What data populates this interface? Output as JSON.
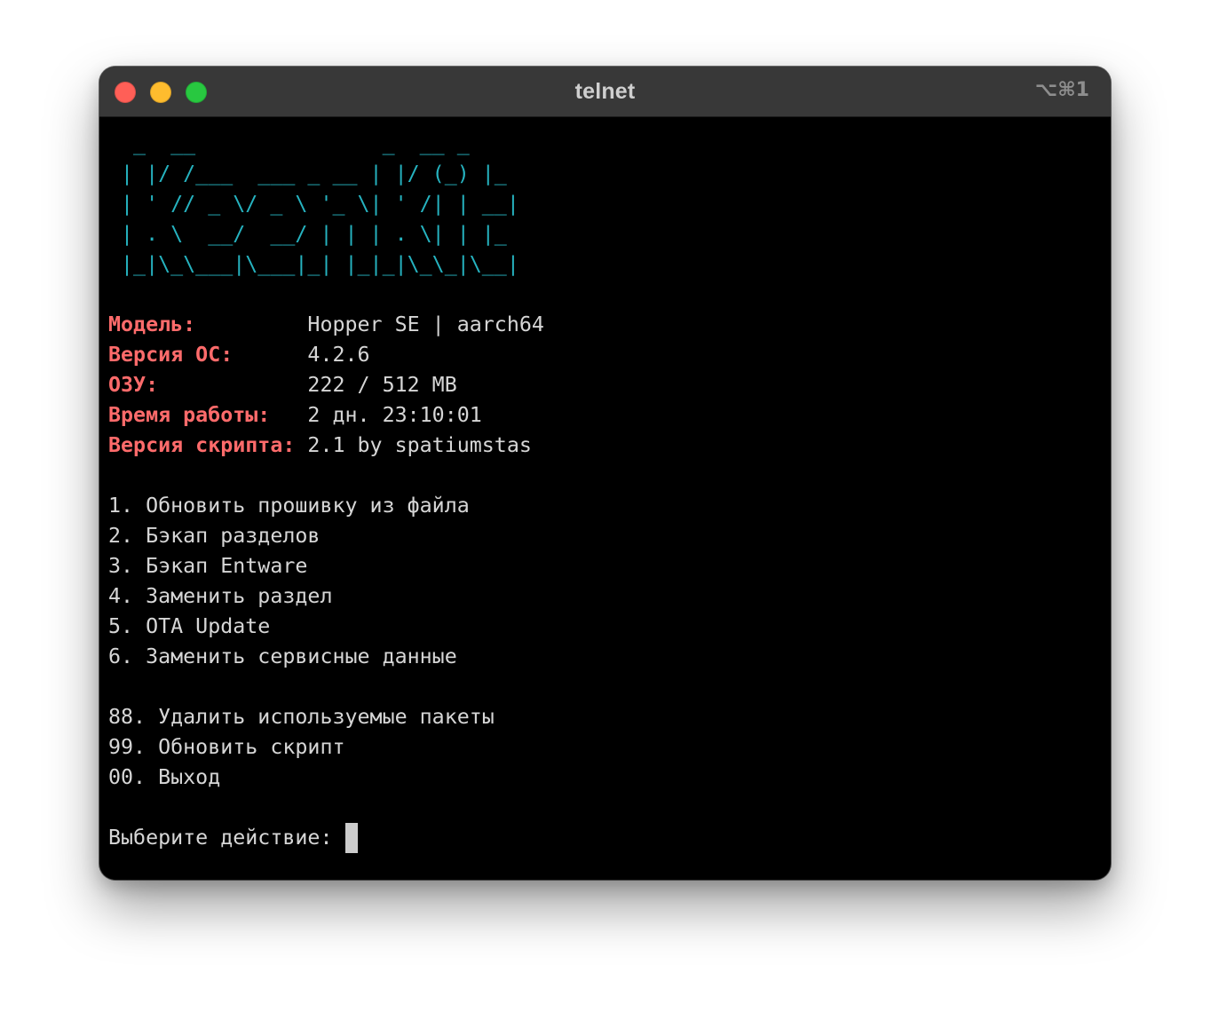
{
  "window": {
    "title": "telnet",
    "shortcut": "⌥⌘1"
  },
  "banner": {
    "lines": [
      "  _  __               _  __ _ ",
      " | |/ /___  ___ _ __ | |/ (_) |_ ",
      " | ' // _ \\/ _ \\ '_ \\| ' /| | __|",
      " | . \\  __/  __/ | | | . \\| | |_ ",
      " |_|\\_\\___|\\___|_| |_|_|\\_\\_|\\__|"
    ]
  },
  "info": [
    {
      "label": "Модель:",
      "pad": "         ",
      "value": "Hopper SE | aarch64"
    },
    {
      "label": "Версия ОС:",
      "pad": "      ",
      "value": "4.2.6"
    },
    {
      "label": "ОЗУ:",
      "pad": "            ",
      "value": "222 / 512 MB"
    },
    {
      "label": "Время работы:",
      "pad": "   ",
      "value": "2 дн. 23:10:01"
    },
    {
      "label": "Версия скрипта:",
      "pad": " ",
      "value": "2.1 by spatiumstas"
    }
  ],
  "menu": {
    "main": [
      "1. Обновить прошивку из файла",
      "2. Бэкап разделов",
      "3. Бэкап Entware",
      "4. Заменить раздел",
      "5. OTA Update",
      "6. Заменить сервисные данные"
    ],
    "extra": [
      "88. Удалить используемые пакеты",
      "99. Обновить скрипт",
      "00. Выход"
    ]
  },
  "prompt": {
    "text": "Выберите действие: "
  },
  "colors": {
    "banner": "#26b3c0",
    "label": "#ff6b6b",
    "text": "#d6d6d6",
    "background": "#000000"
  }
}
